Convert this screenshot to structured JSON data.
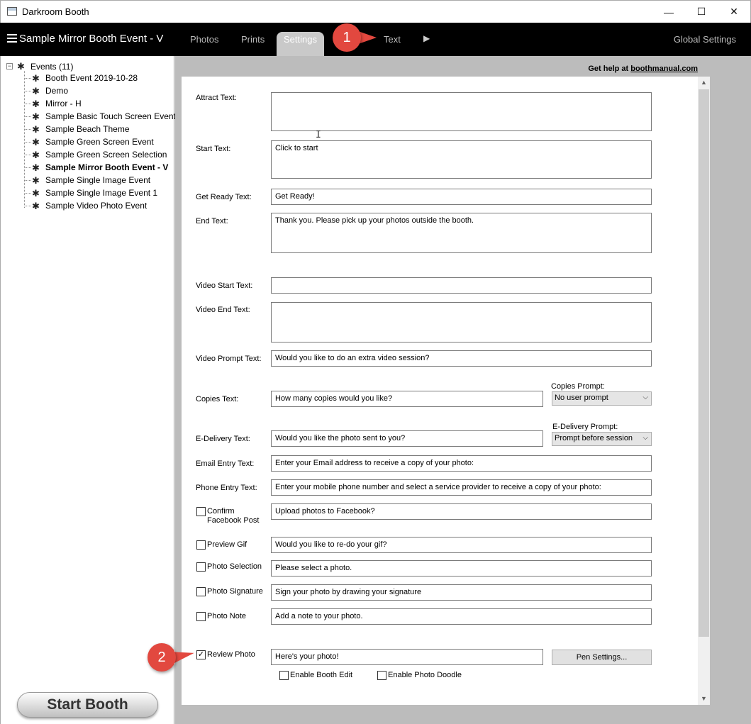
{
  "window": {
    "title": "Darkroom Booth",
    "controls": {
      "minimize": "—",
      "maximize": "☐",
      "close": "✕"
    }
  },
  "navbar": {
    "event_title": "Sample Mirror Booth Event - V",
    "tabs": [
      "Photos",
      "Prints",
      "Settings",
      "Text"
    ],
    "active_tab": "Settings",
    "more_arrow": "▶",
    "global_settings": "Global Settings"
  },
  "callouts": [
    "1",
    "2"
  ],
  "tree": {
    "root_label": "Events (11)",
    "items": [
      "Booth Event 2019-10-28",
      "Demo",
      "Mirror - H",
      "Sample Basic Touch Screen Event",
      "Sample Beach Theme",
      "Sample Green Screen Event",
      "Sample Green Screen Selection",
      "Sample Mirror Booth Event - V",
      "Sample Single Image Event",
      "Sample Single Image Event  1",
      "Sample Video Photo Event"
    ],
    "selected": "Sample Mirror Booth Event - V"
  },
  "start_booth": "Start Booth",
  "help": {
    "prefix": "Get help at ",
    "link": "boothmanual.com"
  },
  "form": {
    "attract": {
      "label": "Attract Text:",
      "value": ""
    },
    "start": {
      "label": "Start Text:",
      "value": "Click to start"
    },
    "get_ready": {
      "label": "Get Ready Text:",
      "value": "Get Ready!"
    },
    "end": {
      "label": "End Text:",
      "value": "Thank you.  Please pick up your photos outside the booth."
    },
    "video_start": {
      "label": "Video Start Text:",
      "value": ""
    },
    "video_end": {
      "label": "Video End Text:",
      "value": ""
    },
    "video_prompt": {
      "label": "Video Prompt Text:",
      "value": "Would you like to do an extra video session?"
    },
    "copies": {
      "label": "Copies Text:",
      "value": "How many copies would you like?"
    },
    "copies_prompt": {
      "label": "Copies Prompt:",
      "value": "No user prompt"
    },
    "edelivery": {
      "label": "E-Delivery Text:",
      "value": "Would you like the photo sent to you?"
    },
    "edelivery_prompt": {
      "label": "E-Delivery Prompt:",
      "value": "Prompt before session"
    },
    "email_entry": {
      "label": "Email Entry Text:",
      "value": "Enter your Email address to receive a copy of your photo:"
    },
    "phone_entry": {
      "label": "Phone Entry Text:",
      "value": "Enter your mobile phone number and select a service provider to receive a copy of your photo:"
    },
    "confirm_facebook": {
      "label_line1": "Confirm",
      "label_line2": "Facebook Post",
      "checked": false,
      "value": "Upload photos to Facebook?"
    },
    "preview_gif": {
      "label": "Preview Gif",
      "checked": false,
      "value": "Would you like to re-do your gif?"
    },
    "photo_selection": {
      "label": "Photo Selection",
      "checked": false,
      "value": "Please select a photo."
    },
    "photo_signature": {
      "label": "Photo Signature",
      "checked": false,
      "value": "Sign your photo by drawing your signature"
    },
    "photo_note": {
      "label": "Photo Note",
      "checked": false,
      "value": "Add a note to your photo."
    },
    "review_photo": {
      "label": "Review Photo",
      "checked": true,
      "value": "Here's your photo!"
    },
    "pen_settings": "Pen Settings...",
    "enable_booth_edit": {
      "label": "Enable Booth Edit",
      "checked": false
    },
    "enable_photo_doodle": {
      "label": "Enable Photo Doodle",
      "checked": false
    }
  },
  "colors": {
    "navbar_bg": "#000000",
    "active_tab_bg": "#c9c9c9",
    "callout": "#e2483f",
    "right_area_bg": "#bcbcbc"
  }
}
